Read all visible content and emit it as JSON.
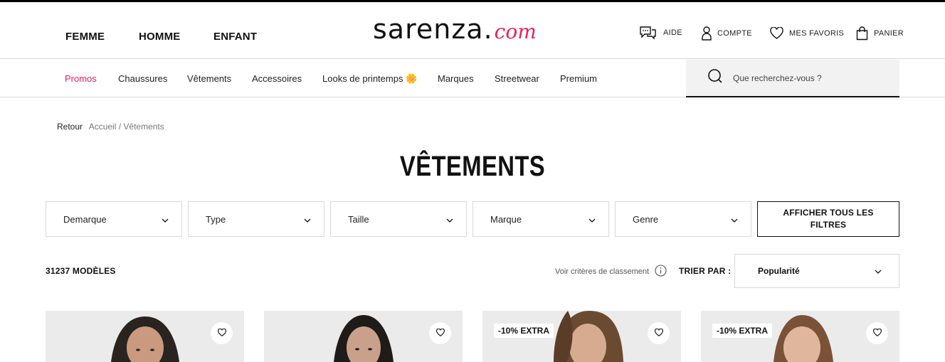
{
  "header": {
    "genders": [
      "FEMME",
      "HOMME",
      "ENFANT"
    ],
    "logo_main": "sarenza.",
    "logo_com": "com",
    "help_label": "AIDE",
    "account_label": "COMPTE",
    "favorites_label": "MES FAVORIS",
    "cart_label": "PANIER"
  },
  "nav": {
    "items": [
      "Promos",
      "Chaussures",
      "Vêtements",
      "Accessoires",
      "Looks de printemps 🌼",
      "Marques",
      "Streetwear",
      "Premium"
    ],
    "search_placeholder": "Que recherchez-vous ?"
  },
  "breadcrumb": {
    "back": "Retour",
    "home": "Accueil",
    "current": "/ Vêtements"
  },
  "page_title": "VÊTEMENTS",
  "filters": [
    "Demarque",
    "Type",
    "Taille",
    "Marque",
    "Genre"
  ],
  "all_filters_label": "AFFICHER TOUS LES FILTRES",
  "results": {
    "count": "31237 MODÈLES",
    "criteria_label": "Voir critères de classement",
    "sort_label": "TRIER PAR :",
    "sort_value": "Popularité"
  },
  "products": [
    {
      "badge": ""
    },
    {
      "badge": ""
    },
    {
      "badge": "-10% EXTRA"
    },
    {
      "badge": "-10% EXTRA"
    }
  ],
  "colors": {
    "accent": "#e8205f",
    "text": "#111111",
    "border": "#d9d9d9",
    "search_bg": "#f2f2f2"
  }
}
